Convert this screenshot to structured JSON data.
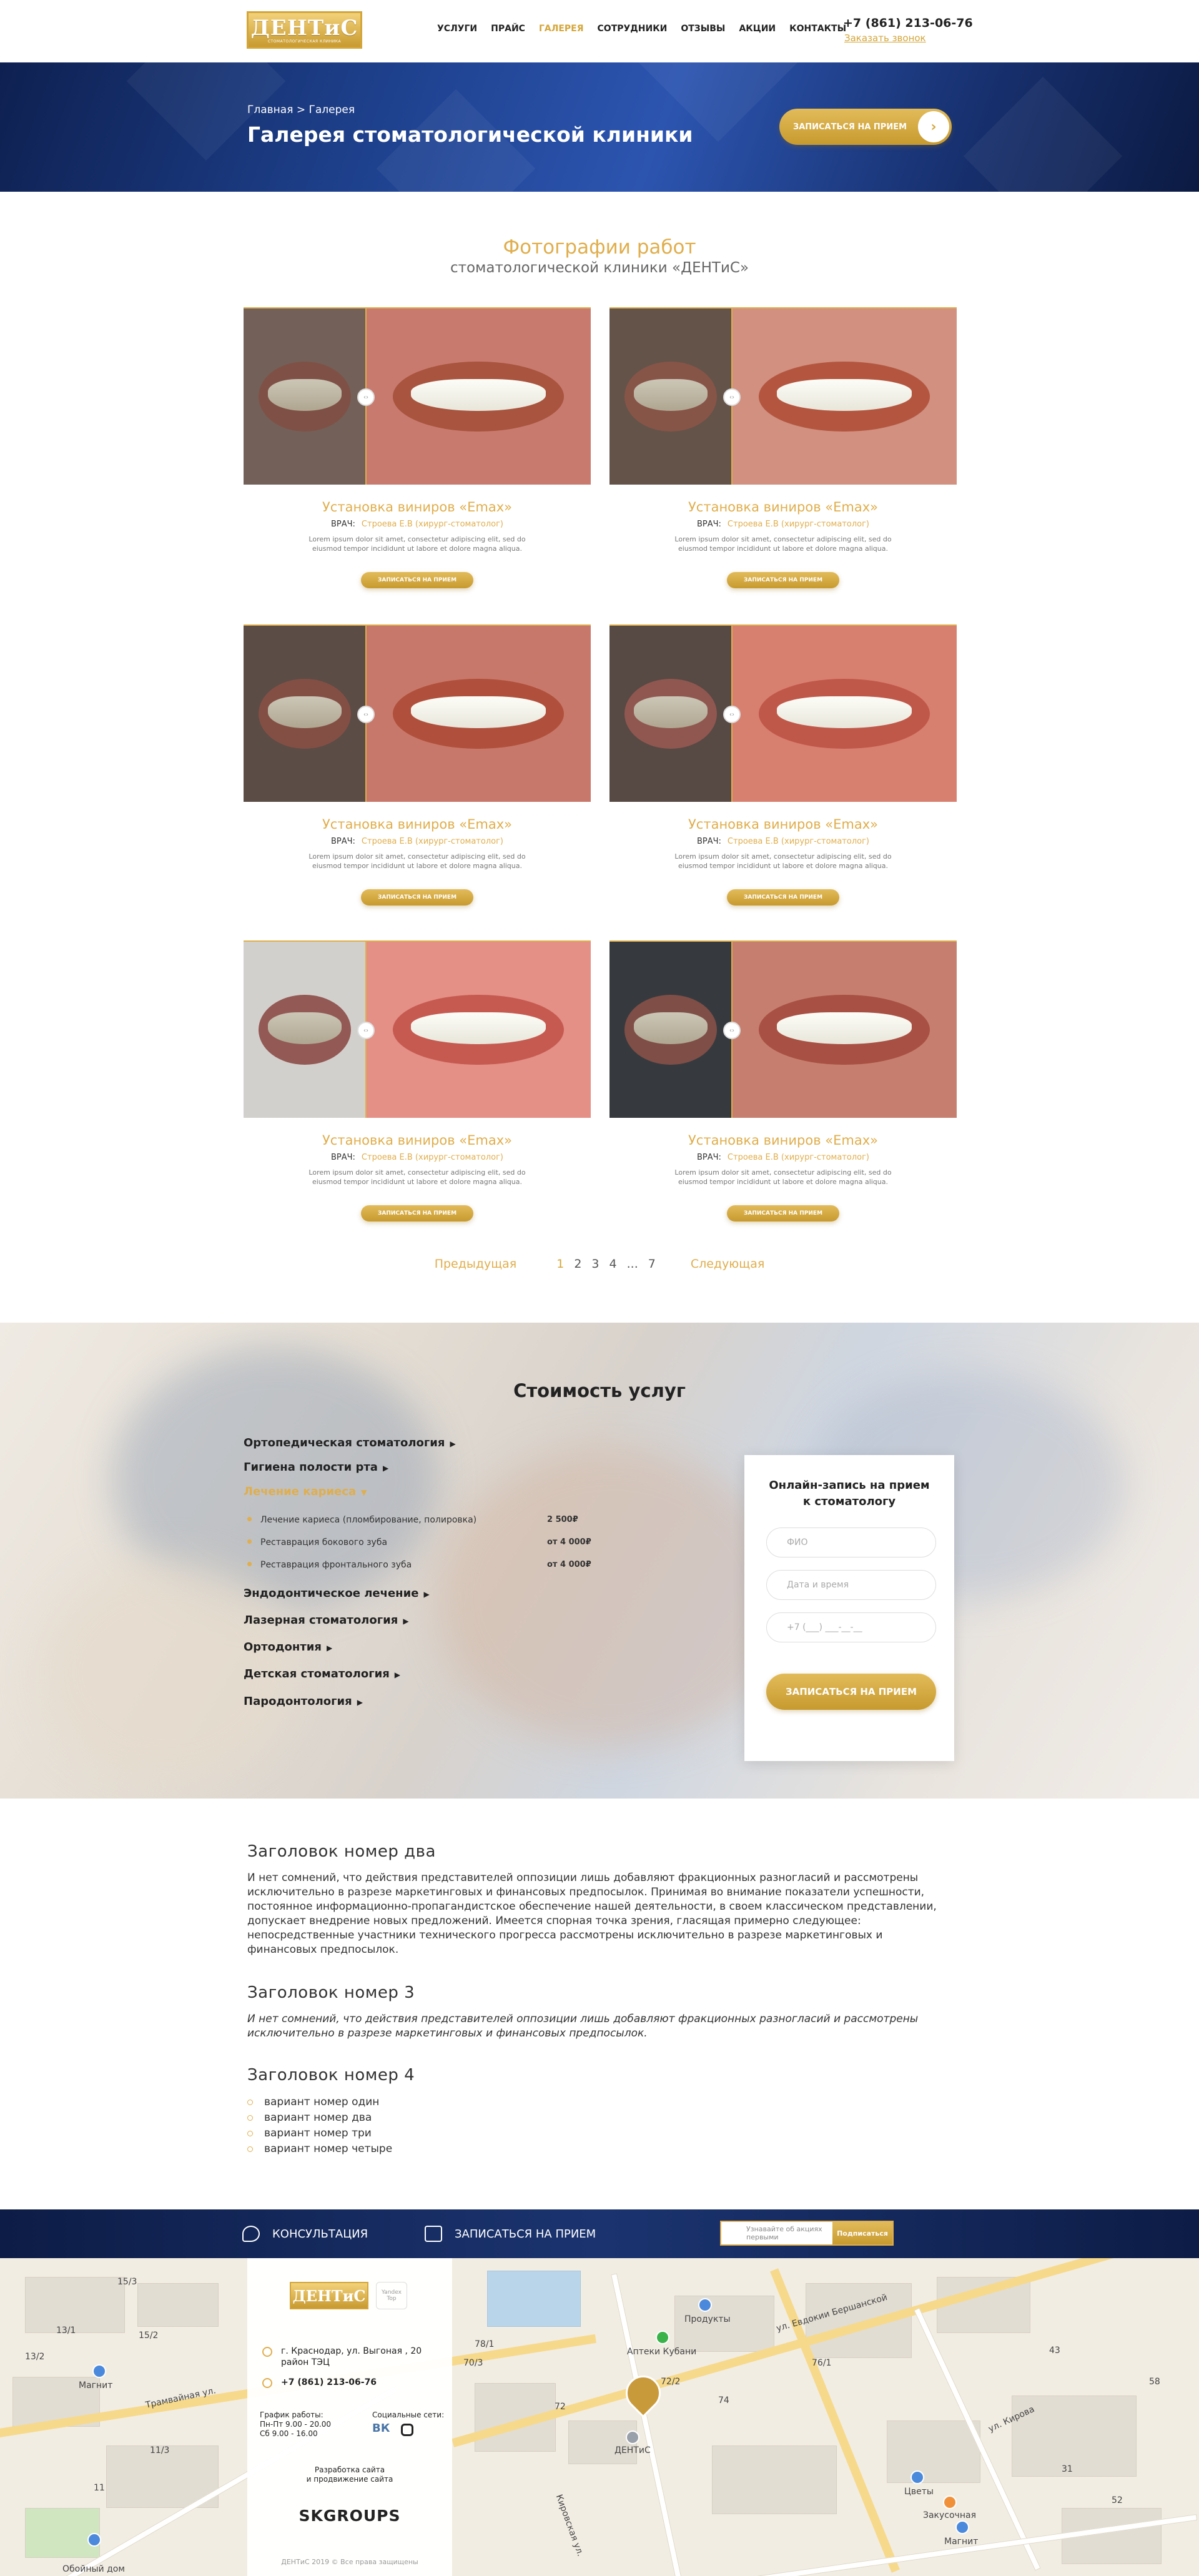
{
  "header": {
    "logo_text": "ДЕНТиС",
    "logo_tagline": "СТОМАТОЛОГИЧЕСКАЯ КЛИНИКА",
    "nav": [
      {
        "label": "УСЛУГИ"
      },
      {
        "label": "ПРАЙС"
      },
      {
        "label": "ГАЛЕРЕЯ",
        "active": true
      },
      {
        "label": "СОТРУДНИКИ"
      },
      {
        "label": "ОТЗЫВЫ"
      },
      {
        "label": "АКЦИИ"
      },
      {
        "label": "КОНТАКТЫ"
      }
    ],
    "phone": "+7 (861) 213-06-76",
    "callback": "Заказать звонок"
  },
  "hero": {
    "crumb_home": "Главная",
    "crumb_sep": " > ",
    "crumb_current": "Галерея",
    "title": "Галерея стоматологической клиники",
    "button": "ЗАПИСАТЬСЯ НА ПРИЕМ",
    "button_icon": "chevron-right-icon"
  },
  "gallery": {
    "title": "Фотографии работ",
    "subtitle": "стоматологической клиники «ДЕНТиС»",
    "cards": [
      {
        "title": "Установка виниров «Emax»",
        "doctor_label": "ВРАЧ:",
        "doctor": "Строева Е.В (хирург-стоматолог)",
        "text": "Lorem ipsum dolor sit amet, consectetur adipiscing elit, sed do eiusmod tempor incididunt ut labore et dolore magna aliqua.",
        "button": "ЗАПИСАТЬСЯ НА ПРИЕМ"
      },
      {
        "title": "Установка виниров «Emax»",
        "doctor_label": "ВРАЧ:",
        "doctor": "Строева Е.В (хирург-стоматолог)",
        "text": "Lorem ipsum dolor sit amet, consectetur adipiscing elit, sed do eiusmod tempor incididunt ut labore et dolore magna aliqua.",
        "button": "ЗАПИСАТЬСЯ НА ПРИЕМ"
      },
      {
        "title": "Установка виниров «Emax»",
        "doctor_label": "ВРАЧ:",
        "doctor": "Строева Е.В (хирург-стоматолог)",
        "text": "Lorem ipsum dolor sit amet, consectetur adipiscing elit, sed do eiusmod tempor incididunt ut labore et dolore magna aliqua.",
        "button": "ЗАПИСАТЬСЯ НА ПРИЕМ"
      },
      {
        "title": "Установка виниров «Emax»",
        "doctor_label": "ВРАЧ:",
        "doctor": "Строева Е.В (хирург-стоматолог)",
        "text": "Lorem ipsum dolor sit amet, consectetur adipiscing elit, sed do eiusmod tempor incididunt ut labore et dolore magna aliqua.",
        "button": "ЗАПИСАТЬСЯ НА ПРИЕМ"
      },
      {
        "title": "Установка виниров «Emax»",
        "doctor_label": "ВРАЧ:",
        "doctor": "Строева Е.В (хирург-стоматолог)",
        "text": "Lorem ipsum dolor sit amet, consectetur adipiscing elit, sed do eiusmod tempor incididunt ut labore et dolore magna aliqua.",
        "button": "ЗАПИСАТЬСЯ НА ПРИЕМ"
      },
      {
        "title": "Установка виниров «Emax»",
        "doctor_label": "ВРАЧ:",
        "doctor": "Строева Е.В (хирург-стоматолог)",
        "text": "Lorem ipsum dolor sit amet, consectetur adipiscing elit, sed do eiusmod tempor incididunt ut labore et dolore magna aliqua.",
        "button": "ЗАПИСАТЬСЯ НА ПРИЕМ"
      }
    ],
    "pager": {
      "prev": "Предыдущая",
      "pages": [
        "1",
        "2",
        "3",
        "4",
        "...",
        "7"
      ],
      "current": "1",
      "next": "Следующая"
    }
  },
  "prices": {
    "title": "Стоимость услуг",
    "categories": [
      {
        "label": "Ортопедическая стоматология"
      },
      {
        "label": "Гигиена полости рта"
      },
      {
        "label": "Лечение кариеса",
        "open": true,
        "items": [
          {
            "label": "Лечение кариеса (пломбирование, полировка)",
            "price": "2 500₽"
          },
          {
            "label": "Реставрация бокового зуба",
            "price": "от 4 000₽"
          },
          {
            "label": "Реставрация фронтального зуба",
            "price": "от 4 000₽"
          }
        ]
      },
      {
        "label": "Эндодонтическое лечение"
      },
      {
        "label": "Лазерная стоматология"
      },
      {
        "label": "Ортодонтия"
      },
      {
        "label": "Детская стоматология"
      },
      {
        "label": "Пародонтология"
      }
    ],
    "form": {
      "title_line1": "Онлайн-запись на прием",
      "title_line2": "к стоматологу",
      "name_placeholder": "ФИО",
      "date_placeholder": "Дата и время",
      "phone_placeholder": "+7 (___) ___-__-__",
      "button": "ЗАПИСАТЬСЯ НА ПРИЕМ"
    }
  },
  "content": {
    "h2": "Заголовок номер два",
    "p1": "И нет сомнений, что действия представителей оппозиции лишь добавляют фракционных разногласий и рассмотрены исключительно в разрезе маркетинговых и финансовых предпосылок. Принимая во внимание показатели успешности, постоянное информационно-пропагандистское обеспечение нашей деятельности, в своем классическом представлении, допускает внедрение новых предложений. Имеется спорная точка зрения, гласящая примерно следующее: непосредственные участники технического прогресса рассмотрены исключительно в разрезе маркетинговых и финансовых предпосылок.",
    "h3": "Заголовок номер 3",
    "p2": "И нет сомнений, что действия представителей оппозиции лишь добавляют фракционных разногласий и рассмотрены исключительно в разрезе маркетинговых и финансовых предпосылок.",
    "h4": "Заголовок номер 4",
    "list": [
      "вариант номер один",
      "вариант номер два",
      "вариант номер три",
      "вариант номер четыре"
    ]
  },
  "band": {
    "consult": "КОНСУЛЬТАЦИЯ",
    "consult_icon": "chat-icon",
    "appoint": "ЗАПИСАТЬСЯ НА ПРИЕМ",
    "appoint_icon": "calendar-icon",
    "subscribe_placeholder": "Узнавайте об акциях первыми",
    "subscribe_button": "Подписаться"
  },
  "footer": {
    "logo_text": "ДЕНТиС",
    "badge": "Yandex Top",
    "address_line1": "г. Краснодар, ул. Выгоная , 20",
    "address_line2": "район ТЭЦ",
    "phone": "+7 (861) 213-06-76",
    "hours_title": "График работы:",
    "hours_1": "Пн-Пт  9.00 - 20.00",
    "hours_2": "Сб  9.00 - 16.00",
    "social_title": "Социальные сети:",
    "dev_line1": "Разработка сайта",
    "dev_line2": "и продвижение сайта",
    "dev_name": "SKGROUPS",
    "copyright": "ДЕНТиС 2019 © Все права защищены"
  },
  "map": {
    "labels": [
      "15/3",
      "13/1",
      "15/2",
      "13/2",
      "11/3",
      "11",
      "Магнит",
      "Трамвайная ул.",
      "Продукты",
      "Аптеки Кубани",
      "ул. Евдокии Бершанской",
      "ДЕНТиС",
      "Цветы",
      "Закусочная",
      "Магнит",
      "ул. Кирова",
      "Кировская ул.",
      "Обойный дом",
      "78/1",
      "70/3",
      "72/2",
      "72",
      "76/1",
      "74",
      "43",
      "31",
      "52",
      "58"
    ]
  }
}
